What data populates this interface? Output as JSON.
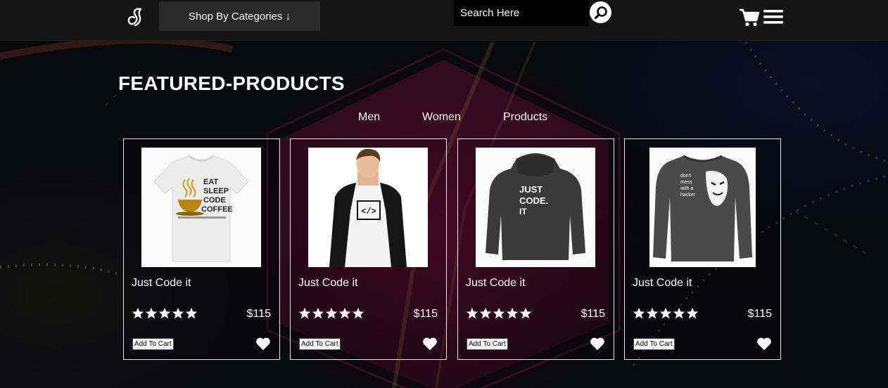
{
  "header": {
    "categories_label": "Shop By Categories ↓",
    "search_placeholder": "Search Here",
    "icons": [
      "logo-icon",
      "search-icon",
      "cart-icon",
      "menu-icon"
    ]
  },
  "section": {
    "title": "FEATURED-PRODUCTS",
    "tabs": [
      "Men",
      "Women",
      "Products"
    ]
  },
  "products": [
    {
      "name": "Just Code it",
      "price": "$115",
      "rating": 5,
      "cart_label": "Add To Cart",
      "image": "eat-sleep-code-coffee-tshirt"
    },
    {
      "name": "Just Code it",
      "price": "$115",
      "rating": 5,
      "cart_label": "Add To Cart",
      "image": "code-symbol-raglan-tshirt"
    },
    {
      "name": "Just Code it",
      "price": "$115",
      "rating": 5,
      "cart_label": "Add To Cart",
      "image": "just-code-it-hoodie"
    },
    {
      "name": "Just Code it",
      "price": "$115",
      "rating": 5,
      "cart_label": "Add To Cart",
      "image": "dont-mess-with-a-hacker-longsleeve"
    }
  ],
  "product_image_text": {
    "p1": [
      "EAT",
      "SLEEP",
      "CODE",
      "COFFEE"
    ],
    "p2": "</>",
    "p3": [
      "JUST",
      "CODE.",
      "IT"
    ],
    "p4": [
      "don't",
      "mess",
      "with a",
      "hacker"
    ]
  },
  "colors": {
    "header_bg": "#141414",
    "button_bg": "#2a2a2a",
    "page_bg": "#08080f",
    "accent_glow": "#780a3c"
  }
}
